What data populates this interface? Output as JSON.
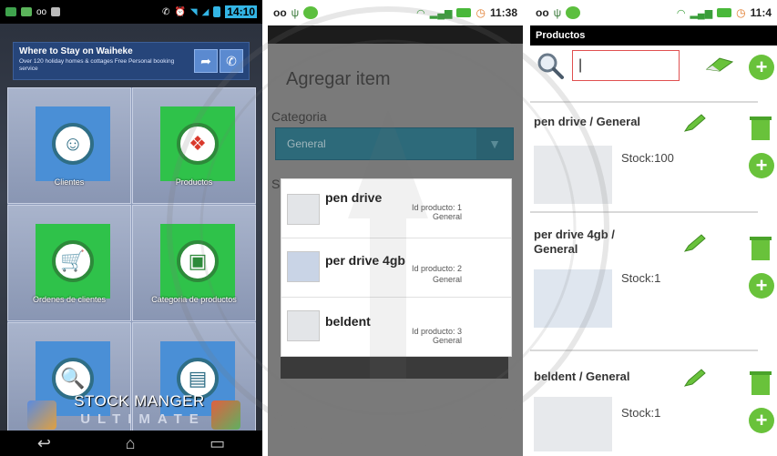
{
  "panel1": {
    "status_time": "14:10",
    "ad": {
      "title": "Where to Stay on Waiheke",
      "subtitle": "Over 120 holiday homes & cottages Free Personal booking service"
    },
    "tiles": [
      {
        "label": "Clientes"
      },
      {
        "label": "Productos"
      },
      {
        "label": "Ordenes de clientes"
      },
      {
        "label": "Categoria de productos"
      }
    ],
    "app_title": "STOCK MANGER",
    "app_subtitle": "ULTIMATE"
  },
  "panel2": {
    "status_time": "11:38",
    "title": "Agregar item",
    "category_label": "Categoria",
    "spinner_value": "General",
    "second_label": "S",
    "items": [
      {
        "name": "pen drive",
        "id": "Id producto: 1",
        "category": "General"
      },
      {
        "name": "per drive 4gb",
        "id": "Id producto: 2",
        "category": "General"
      },
      {
        "name": "beldent",
        "id": "Id producto: 3",
        "category": "General"
      }
    ]
  },
  "panel3": {
    "status_time": "11:4",
    "title": "Productos",
    "search_value": "|",
    "products": [
      {
        "title": "pen drive / General",
        "stock": "Stock:100"
      },
      {
        "title": "per drive 4gb / General",
        "stock": "Stock:1"
      },
      {
        "title": "beldent / General",
        "stock": "Stock:1"
      }
    ]
  },
  "colors": {
    "accent_green": "#69c23b",
    "tile_blue": "#4a8fd6",
    "tile_green": "#2fc24a",
    "spinner_teal": "#2d6a7a"
  }
}
